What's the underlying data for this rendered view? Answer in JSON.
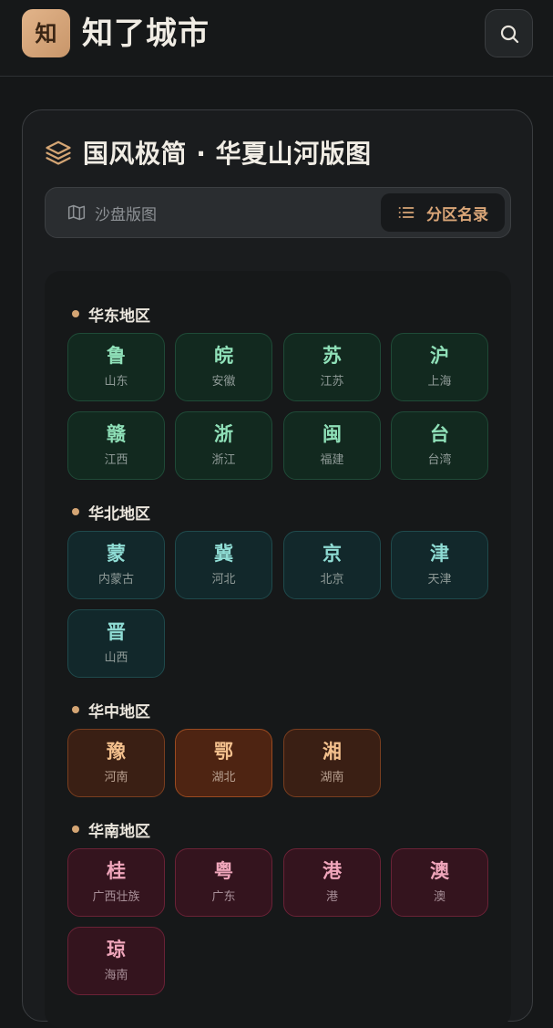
{
  "app": {
    "logo_text": "知",
    "title": "知了城市"
  },
  "card": {
    "title": "国风极简 · 华夏山河版图"
  },
  "tabs": [
    {
      "label": "沙盘版图",
      "icon": "map-icon",
      "selected": false
    },
    {
      "label": "分区名录",
      "icon": "list-icon",
      "selected": true
    }
  ],
  "regions": [
    {
      "name": "华东地区",
      "provinces": [
        {
          "abbr": "鲁",
          "name": "山东"
        },
        {
          "abbr": "皖",
          "name": "安徽"
        },
        {
          "abbr": "苏",
          "name": "江苏"
        },
        {
          "abbr": "沪",
          "name": "上海"
        },
        {
          "abbr": "赣",
          "name": "江西"
        },
        {
          "abbr": "浙",
          "name": "浙江"
        },
        {
          "abbr": "闽",
          "name": "福建"
        },
        {
          "abbr": "台",
          "name": "台湾"
        }
      ]
    },
    {
      "name": "华北地区",
      "provinces": [
        {
          "abbr": "蒙",
          "name": "内蒙古"
        },
        {
          "abbr": "冀",
          "name": "河北"
        },
        {
          "abbr": "京",
          "name": "北京"
        },
        {
          "abbr": "津",
          "name": "天津"
        },
        {
          "abbr": "晋",
          "name": "山西"
        }
      ]
    },
    {
      "name": "华中地区",
      "provinces": [
        {
          "abbr": "豫",
          "name": "河南"
        },
        {
          "abbr": "鄂",
          "name": "湖北"
        },
        {
          "abbr": "湘",
          "name": "湖南"
        }
      ]
    },
    {
      "name": "华南地区",
      "provinces": [
        {
          "abbr": "桂",
          "name": "广西壮族"
        },
        {
          "abbr": "粤",
          "name": "广东"
        },
        {
          "abbr": "港",
          "name": "港"
        },
        {
          "abbr": "澳",
          "name": "澳"
        },
        {
          "abbr": "琼",
          "name": "海南"
        }
      ]
    }
  ],
  "colors": {
    "accent": "#d4a574",
    "east": "#8fe0b8",
    "north": "#8fdcd4",
    "central": "#f3c08d",
    "south": "#f0a6bb"
  }
}
